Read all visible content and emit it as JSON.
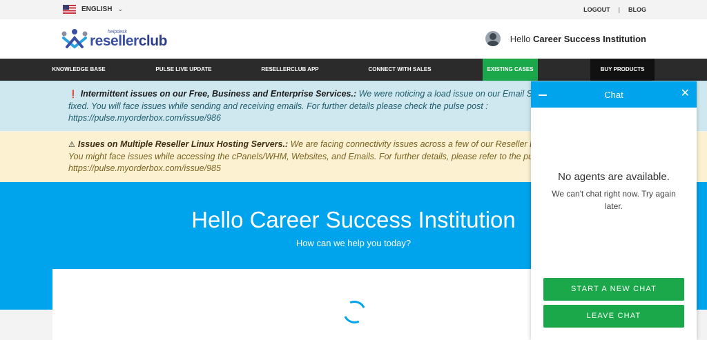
{
  "topbar": {
    "language": "ENGLISH",
    "flag_icon": "us-flag-icon",
    "logout": "LOGOUT",
    "separator": "|",
    "blog": "BLOG"
  },
  "header": {
    "logo_small": "helpdesk",
    "logo_main_a": "reseller",
    "logo_main_b": "club",
    "greeting": "Hello",
    "user_name": "Career Success Institution"
  },
  "nav": {
    "items": [
      {
        "label": "KNOWLEDGE BASE"
      },
      {
        "label": "PULSE LIVE UPDATE"
      },
      {
        "label": "RESELLERCLUB APP"
      },
      {
        "label": "CONNECT WITH SALES"
      },
      {
        "label": "EXISTING CASES"
      },
      {
        "label": "BUY PRODUCTS"
      }
    ]
  },
  "alerts": [
    {
      "icon": "exclamation-circle-icon",
      "title": "Intermittent issues on our Free, Business and Enterprise Services.:",
      "line1": "We were noticing a load issue on our Email Se",
      "line2": "fixed. You will face issues while sending and receiving emails. For further details please check the pulse post :",
      "line3": "https://pulse.myorderbox.com/issue/986"
    },
    {
      "icon": "warning-triangle-icon",
      "title": "Issues on Multiple Reseller Linux Hosting Servers.:",
      "line1": "We are facing connectivity issues across a few of our Reseller Li",
      "line2": "You might face issues while accessing the cPanels/WHM, Websites, and Emails. For further details, please refer to the pu",
      "line3": "https://pulse.myorderbox.com/issue/985"
    }
  ],
  "hero": {
    "title": "Hello Career Success Institution",
    "subtitle": "How can we help you today?"
  },
  "chat": {
    "title": "Chat",
    "no_agents": "No agents are available.",
    "cant_chat": "We can't chat right now. Try again later.",
    "start_button": "START A NEW CHAT",
    "leave_button": "LEAVE CHAT"
  },
  "colors": {
    "brand_blue": "#00a4ec",
    "nav_dark": "#2b2b2b",
    "green": "#1aa84a"
  }
}
